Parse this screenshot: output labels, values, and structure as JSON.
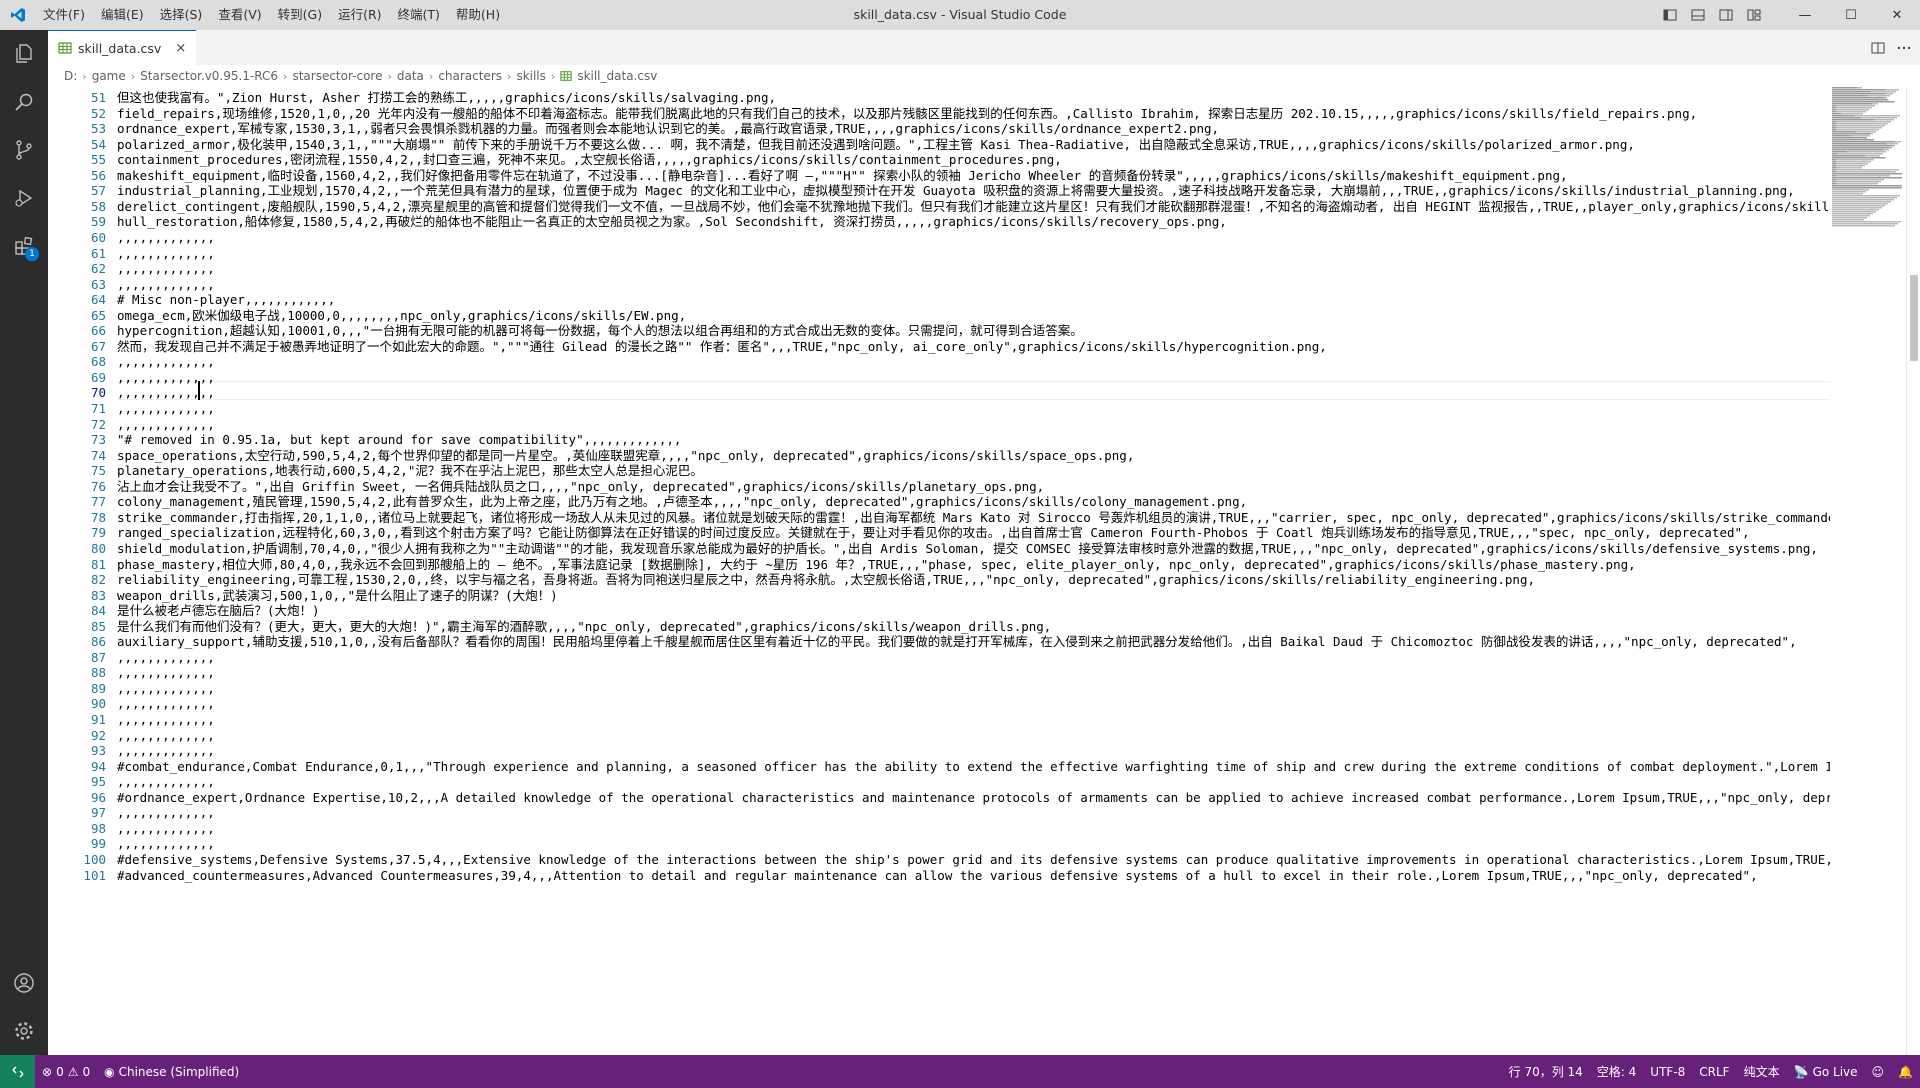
{
  "window": {
    "title": "skill_data.csv - Visual Studio Code",
    "menu": [
      "文件(F)",
      "编辑(E)",
      "选择(S)",
      "查看(V)",
      "转到(G)",
      "运行(R)",
      "终端(T)",
      "帮助(H)"
    ],
    "min": "—",
    "max": "☐",
    "close": "✕"
  },
  "tab": {
    "label": "skill_data.csv",
    "close": "×"
  },
  "breadcrumb": [
    "D:",
    "game",
    "Starsector.v0.95.1-RC6",
    "starsector-core",
    "data",
    "characters",
    "skills",
    "skill_data.csv"
  ],
  "breadcrumb_sep": "›",
  "editor": {
    "first_line_number": 51,
    "cursor_line": 70,
    "cursor_col": 14,
    "lines": [
      "但这也使我富有。\",Zion Hurst, Asher 打捞工会的熟练工,,,,,graphics/icons/skills/salvaging.png,",
      "field_repairs,现场维修,1520,1,0,,20 光年内没有一艘船的船体不印着海盗标志。能带我们脱离此地的只有我们自己的技术，以及那片残骸区里能找到的任何东西。,Callisto Ibrahim, 探索日志星历 202.10.15,,,,,graphics/icons/skills/field_repairs.png,",
      "ordnance_expert,军械专家,1530,3,1,,弱者只会畏惧杀戮机器的力量。而强者则会本能地认识到它的美。,最高行政官语录,TRUE,,,,graphics/icons/skills/ordnance_expert2.png,",
      "polarized_armor,极化装甲,1540,3,1,,\"\"\"大崩塌\"\" 前传下来的手册说千万不要这么做... 啊，我不清楚，但我目前还没遇到啥问题。\",工程主管 Kasi Thea-Radiative, 出自隐蔽式全息采访,TRUE,,,,graphics/icons/skills/polarized_armor.png,",
      "containment_procedures,密闭流程,1550,4,2,,封口查三遍，死神不来见。,太空舰长俗语,,,,,graphics/icons/skills/containment_procedures.png,",
      "makeshift_equipment,临时设备,1560,4,2,,我们好像把备用零件忘在轨道了，不过没事...[静电杂音]...看好了啊 —,\"\"\"H\"\" 探索小队的领袖 Jericho Wheeler 的音频备份转录\",,,,,graphics/icons/skills/makeshift_equipment.png,",
      "industrial_planning,工业规划,1570,4,2,,一个荒芜但具有潜力的星球，位置便于成为 Magec 的文化和工业中心，虚拟模型预计在开发 Guayota 吸积盘的资源上将需要大量投资。,速子科技战略开发备忘录, 大崩塌前,,,TRUE,,graphics/icons/skills/industrial_planning.png,",
      "derelict_contingent,废船舰队,1590,5,4,2,漂亮星舰里的高管和提督们觉得我们一文不值，一旦战局不妙，他们会毫不犹豫地抛下我们。但只有我们才能建立这片星区！只有我们才能砍翻那群混蛋！,不知名的海盗煽动者, 出自 HEGINT 监视报告,,TRUE,,player_only,graphics/icons/skills/derelict_contingent.png,",
      "hull_restoration,船体修复,1580,5,4,2,再破烂的船体也不能阻止一名真正的太空船员视之为家。,Sol Secondshift, 资深打捞员,,,,,graphics/icons/skills/recovery_ops.png,",
      ",,,,,,,,,,,,,",
      ",,,,,,,,,,,,,",
      ",,,,,,,,,,,,,",
      ",,,,,,,,,,,,,",
      "# Misc non-player,,,,,,,,,,,,",
      "omega_ecm,欧米伽级电子战,10000,0,,,,,,,,npc_only,graphics/icons/skills/EW.png,",
      "hypercognition,超越认知,10001,0,,,\"一台拥有无限可能的机器可将每一份数据，每个人的想法以组合再组和的方式合成出无数的变体。只需提问，就可得到合适答案。",
      "然而，我发现自己并不满足于被愚弄地证明了一个如此宏大的命题。\",\"\"\"通往 Gilead 的漫长之路\"\" 作者：匿名\",,,TRUE,\"npc_only, ai_core_only\",graphics/icons/skills/hypercognition.png,",
      ",,,,,,,,,,,,,",
      ",,,,,,,,,,,,,",
      ",,,,,,,,,,,,,",
      ",,,,,,,,,,,,,",
      ",,,,,,,,,,,,,",
      "\"# removed in 0.95.1a, but kept around for save compatibility\",,,,,,,,,,,,,",
      "space_operations,太空行动,590,5,4,2,每个世界仰望的都是同一片星空。,英仙座联盟宪章,,,,\"npc_only, deprecated\",graphics/icons/skills/space_ops.png,",
      "planetary_operations,地表行动,600,5,4,2,\"泥？我不在乎沾上泥巴，那些太空人总是担心泥巴。",
      "沾上血才会让我受不了。\",出自 Griffin Sweet, 一名佣兵陆战队员之口,,,,\"npc_only, deprecated\",graphics/icons/skills/planetary_ops.png,",
      "colony_management,殖民管理,1590,5,4,2,此有普罗众生，此为上帝之座，此乃万有之地。,卢德圣本,,,,\"npc_only, deprecated\",graphics/icons/skills/colony_management.png,",
      "strike_commander,打击指挥,20,1,1,0,,诸位马上就要起飞，诸位将形成一场敌人从未见过的风暴。诸位就是划破天际的雷霆！,出自海军都统 Mars Kato 对 Sirocco 号轰炸机组员的演讲,TRUE,,,\"carrier, spec, npc_only, deprecated\",graphics/icons/skills/strike_commander.png,",
      "ranged_specialization,远程特化,60,3,0,,看到这个射击方案了吗？它能让防御算法在正好错误的时间过度反应。关键就在于，要让对手看见你的攻击。,出自首席士官 Cameron Fourth-Phobos 于 Coatl 炮兵训练场发布的指导意见,TRUE,,,\"spec, npc_only, deprecated\",",
      "shield_modulation,护盾调制,70,4,0,,\"很少人拥有我称之为\"\"主动调谐\"\"的才能，我发现音乐家总能成为最好的护盾长。\",出自 Ardis Soloman, 提交 COMSEC 接受算法审核时意外泄露的数据,TRUE,,,\"npc_only, deprecated\",graphics/icons/skills/defensive_systems.png,",
      "phase_mastery,相位大师,80,4,0,,我永远不会回到那艘船上的 — 绝不。,军事法庭记录 [数据删除], 大约于 ~星历 196 年？,TRUE,,,\"phase, spec, elite_player_only, npc_only, deprecated\",graphics/icons/skills/phase_mastery.png,",
      "reliability_engineering,可靠工程,1530,2,0,,终，以宇与福之名，吾身将逝。吾将为同袍送归星辰之中，然吾舟将永航。,太空舰长俗语,TRUE,,,\"npc_only, deprecated\",graphics/icons/skills/reliability_engineering.png,",
      "weapon_drills,武装演习,500,1,0,,\"是什么阻止了速子的阴谋？(大炮！)",
      "是什么被老卢德忘在脑后？(大炮！)",
      "是什么我们有而他们没有？(更大，更大，更大的大炮！)\",霸主海军的酒醉歌,,,,\"npc_only, deprecated\",graphics/icons/skills/weapon_drills.png,",
      "auxiliary_support,辅助支援,510,1,0,,没有后备部队？看看你的周围！民用船坞里停着上千艘星舰而居住区里有着近十亿的平民。我们要做的就是打开军械库，在入侵到来之前把武器分发给他们。,出自 Baikal Daud 于 Chicomoztoc 防御战役发表的讲话,,,,\"npc_only, deprecated\",",
      ",,,,,,,,,,,,,",
      ",,,,,,,,,,,,,",
      ",,,,,,,,,,,,,",
      ",,,,,,,,,,,,,",
      ",,,,,,,,,,,,,",
      ",,,,,,,,,,,,,",
      ",,,,,,,,,,,,,",
      "#combat_endurance,Combat Endurance,0,1,,,\"Through experience and planning, a seasoned officer has the ability to extend the effective warfighting time of ship and crew during the extreme conditions of combat deployment.\",Lorem Ipsum,TRUE,,,\"npc_only\",",
      ",,,,,,,,,,,,,",
      "#ordnance_expert,Ordnance Expertise,10,2,,,A detailed knowledge of the operational characteristics and maintenance protocols of armaments can be applied to achieve increased combat performance.,Lorem Ipsum,TRUE,,,\"npc_only, deprecated\",",
      ",,,,,,,,,,,,,",
      ",,,,,,,,,,,,,",
      ",,,,,,,,,,,,,",
      "#defensive_systems,Defensive Systems,37.5,4,,,Extensive knowledge of the interactions between the ship's power grid and its defensive systems can produce qualitative improvements in operational characteristics.,Lorem Ipsum,TRUE,,,\"npc_only, deprecated\",",
      "#advanced_countermeasures,Advanced Countermeasures,39,4,,,Attention to detail and regular maintenance can allow the various defensive systems of a hull to excel in their role.,Lorem Ipsum,TRUE,,,\"npc_only, deprecated\","
    ]
  },
  "statusbar": {
    "errors": "0",
    "warnings": "0",
    "language_pack": "Chinese (Simplified)",
    "position": "行 70，列 14",
    "spaces": "空格: 4",
    "encoding": "UTF-8",
    "eol": "CRLF",
    "language": "纯文本",
    "golive": "Go Live"
  },
  "colors": {
    "titlebar": "#dddddd",
    "activitybar": "#2c2c2c",
    "statusbar": "#68217a",
    "remote": "#16825d",
    "line_number": "#237893",
    "accent": "#0078d4"
  }
}
